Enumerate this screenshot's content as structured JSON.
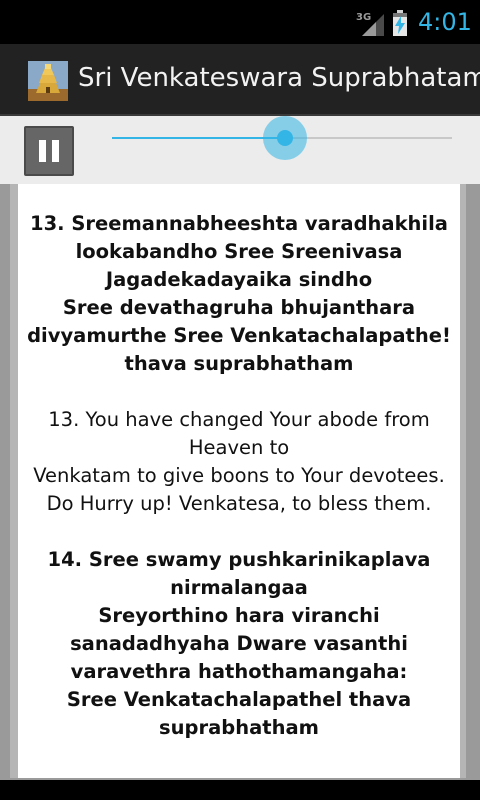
{
  "status_bar": {
    "network": "3G",
    "time": "4:01",
    "accent": "#33b5e5"
  },
  "action_bar": {
    "title": "Sri Venkateswara Suprabhatam",
    "icon": "temple-icon"
  },
  "player": {
    "state_icon": "pause-icon",
    "progress": 0.51
  },
  "content": {
    "blocks": [
      {
        "style": "bold",
        "lines": [
          "13. Sreemannabheeshta varadhakhila",
          "lookabandho Sree Sreenivasa",
          "Jagadekadayaika sindho",
          "Sree devathagruha bhujanthara",
          "divyamurthe Sree Venkatachalapathe!",
          "thava suprabhatham"
        ]
      },
      {
        "style": "normal",
        "lines": [
          "13. You have changed Your abode from",
          "Heaven to",
          "Venkatam to give boons to Your devotees.",
          "Do Hurry up! Venkatesa, to bless them."
        ]
      },
      {
        "style": "bold",
        "lines": [
          "14. Sree swamy pushkarinikaplava",
          "nirmalangaa",
          "Sreyorthino hara viranchi",
          "sanadadhyaha Dware vasanthi",
          "varavethra hathothamangaha:",
          "Sree Venkatachalapathel thava",
          "suprabhatham"
        ]
      }
    ]
  }
}
